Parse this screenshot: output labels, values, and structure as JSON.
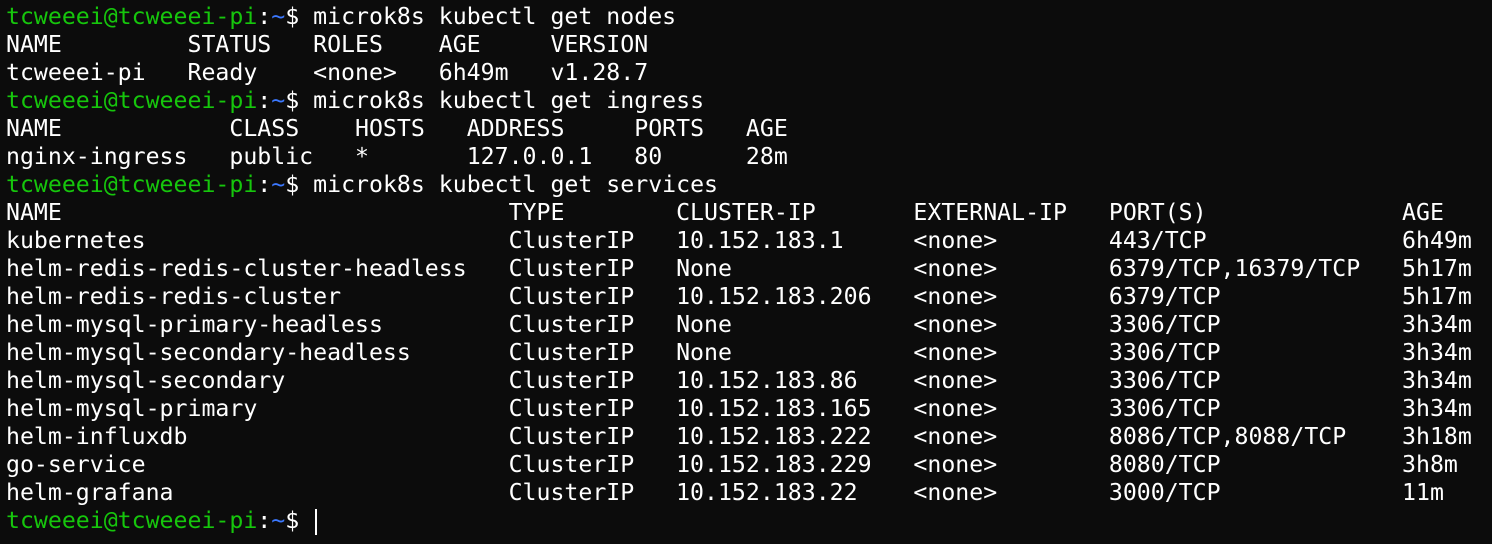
{
  "terminal": {
    "prompt_user_host": "tcweeei@tcweeei-pi",
    "prompt_sep": ":",
    "prompt_path": "~",
    "prompt_dollar": "$",
    "nodes": {
      "command": " microk8s kubectl get nodes",
      "headers": [
        "NAME",
        "STATUS",
        "ROLES",
        "AGE",
        "VERSION"
      ],
      "rows": [
        [
          "tcweeei-pi",
          "Ready",
          "<none>",
          "6h49m",
          "v1.28.7"
        ]
      ]
    },
    "ingress": {
      "command": " microk8s kubectl get ingress",
      "headers": [
        "NAME",
        "CLASS",
        "HOSTS",
        "ADDRESS",
        "PORTS",
        "AGE"
      ],
      "rows": [
        [
          "nginx-ingress",
          "public",
          "*",
          "127.0.0.1",
          "80",
          "28m"
        ]
      ]
    },
    "services": {
      "command": " microk8s kubectl get services",
      "headers": [
        "NAME",
        "TYPE",
        "CLUSTER-IP",
        "EXTERNAL-IP",
        "PORT(S)",
        "AGE"
      ],
      "rows": [
        [
          "kubernetes",
          "ClusterIP",
          "10.152.183.1",
          "<none>",
          "443/TCP",
          "6h49m"
        ],
        [
          "helm-redis-redis-cluster-headless",
          "ClusterIP",
          "None",
          "<none>",
          "6379/TCP,16379/TCP",
          "5h17m"
        ],
        [
          "helm-redis-redis-cluster",
          "ClusterIP",
          "10.152.183.206",
          "<none>",
          "6379/TCP",
          "5h17m"
        ],
        [
          "helm-mysql-primary-headless",
          "ClusterIP",
          "None",
          "<none>",
          "3306/TCP",
          "3h34m"
        ],
        [
          "helm-mysql-secondary-headless",
          "ClusterIP",
          "None",
          "<none>",
          "3306/TCP",
          "3h34m"
        ],
        [
          "helm-mysql-secondary",
          "ClusterIP",
          "10.152.183.86",
          "<none>",
          "3306/TCP",
          "3h34m"
        ],
        [
          "helm-mysql-primary",
          "ClusterIP",
          "10.152.183.165",
          "<none>",
          "3306/TCP",
          "3h34m"
        ],
        [
          "helm-influxdb",
          "ClusterIP",
          "10.152.183.222",
          "<none>",
          "8086/TCP,8088/TCP",
          "3h18m"
        ],
        [
          "go-service",
          "ClusterIP",
          "10.152.183.229",
          "<none>",
          "8080/TCP",
          "3h8m"
        ],
        [
          "helm-grafana",
          "ClusterIP",
          "10.152.183.22",
          "<none>",
          "3000/TCP",
          "11m"
        ]
      ]
    },
    "colors": {
      "background": "#0c0c0c",
      "text": "#ffffff",
      "prompt_user": "#16c60c",
      "prompt_path": "#3b78ff"
    }
  }
}
